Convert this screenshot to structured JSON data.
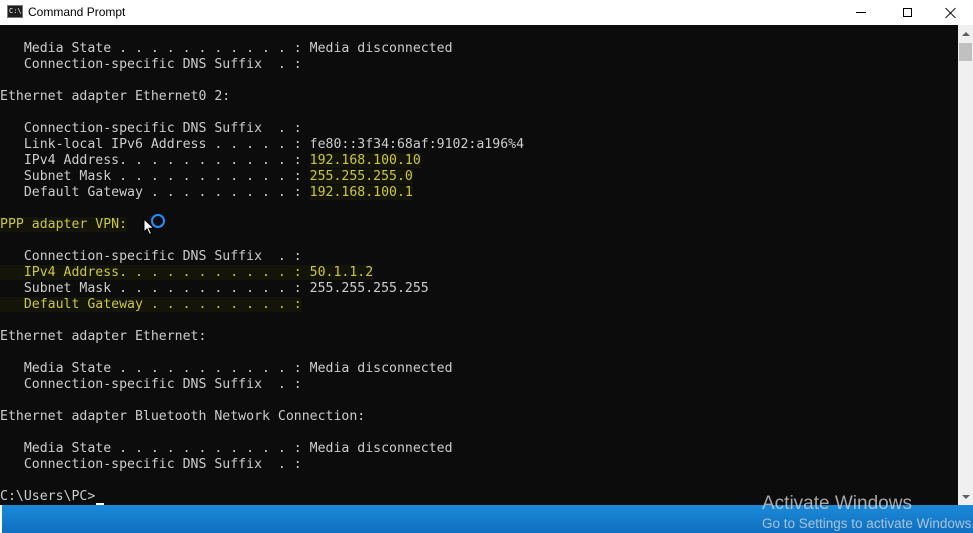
{
  "window": {
    "title": "Command Prompt",
    "icon": "cmd-icon",
    "controls": [
      "minimize-icon",
      "maximize-icon",
      "close-icon"
    ]
  },
  "colors": {
    "default_text": "#cccccc",
    "highlight_text": "#c8c83c",
    "background": "#0c0c0c",
    "taskbar": "#1478cc"
  },
  "console": {
    "lines": [
      {
        "text": "   Media State . . . . . . . . . . . : Media disconnected"
      },
      {
        "text": "   Connection-specific DNS Suffix  . :"
      },
      {
        "text": ""
      },
      {
        "text": "Ethernet adapter Ethernet0 2:"
      },
      {
        "text": ""
      },
      {
        "text": "   Connection-specific DNS Suffix  . :"
      },
      {
        "text": "   Link-local IPv6 Address . . . . . : fe80::3f34:68af:9102:a196%4"
      },
      {
        "text": "   IPv4 Address. . . . . . . . . . . : ",
        "value": "192.168.100.10"
      },
      {
        "text": "   Subnet Mask . . . . . . . . . . . : ",
        "value": "255.255.255.0"
      },
      {
        "text": "   Default Gateway . . . . . . . . . : ",
        "value": "192.168.100.1"
      },
      {
        "text": ""
      },
      {
        "text": "PPP adapter VPN:",
        "highlight": true
      },
      {
        "text": ""
      },
      {
        "text": "   Connection-specific DNS Suffix  . :"
      },
      {
        "text": "   IPv4 Address. . . . . . . . . . . : 50.1.1.2",
        "highlight": true
      },
      {
        "text": "   Subnet Mask . . . . . . . . . . . : 255.255.255.255"
      },
      {
        "text": "   Default Gateway . . . . . . . . . :",
        "highlight": true
      },
      {
        "text": ""
      },
      {
        "text": "Ethernet adapter Ethernet:"
      },
      {
        "text": ""
      },
      {
        "text": "   Media State . . . . . . . . . . . : Media disconnected"
      },
      {
        "text": "   Connection-specific DNS Suffix  . :"
      },
      {
        "text": ""
      },
      {
        "text": "Ethernet adapter Bluetooth Network Connection:"
      },
      {
        "text": ""
      },
      {
        "text": "   Media State . . . . . . . . . . . : Media disconnected"
      },
      {
        "text": "   Connection-specific DNS Suffix  . :"
      },
      {
        "text": ""
      },
      {
        "text": "C:\\Users\\PC>"
      }
    ]
  },
  "watermark": {
    "title": "Activate Windows",
    "subtitle": "Go to Settings to activate Windows."
  }
}
